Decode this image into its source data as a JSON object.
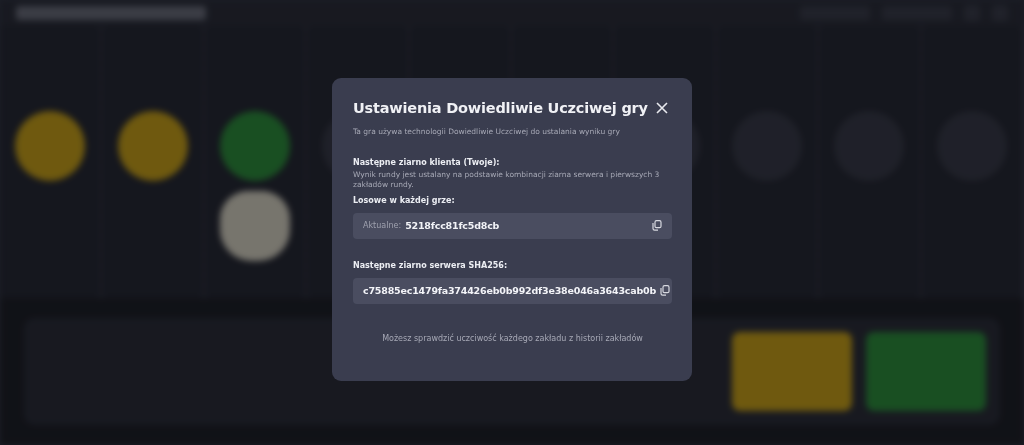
{
  "dialog": {
    "title": "Ustawienia Dowiedliwie Uczciwej gry",
    "subtitle": "Ta gra używa technologii Dowiedliwie Uczciwej do ustalania wyniku gry",
    "client_seed": {
      "heading": "Następne ziarno klienta (Twoje):",
      "description": "Wynik rundy jest ustalany na podstawie kombinacji ziarna serwera i pierwszych 3 zakładów rundy.",
      "mode_label": "Losowe w każdej grze:",
      "prefix": "Aktualne:",
      "value": "5218fcc81fc5d8cb"
    },
    "server_seed": {
      "heading": "Następne ziarno serwera SHA256:",
      "value": "c75885ec1479fa374426eb0b992df3e38e046a3643cab0b"
    },
    "footer": "Możesz sprawdzić uczciwość każdego zakładu z historii zakładów"
  }
}
